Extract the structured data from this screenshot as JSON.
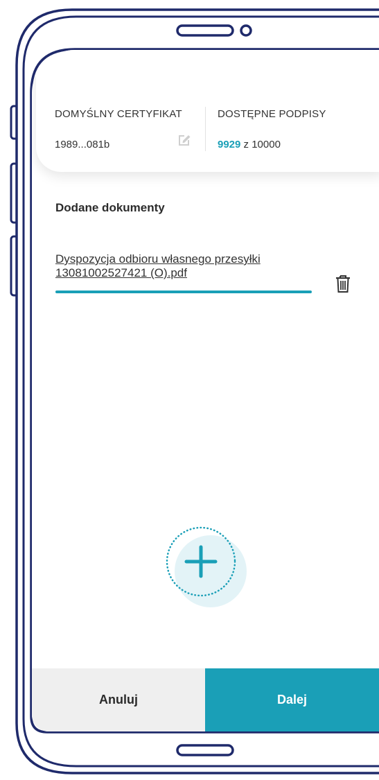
{
  "certificate": {
    "title": "DOMYŚLNY CERTYFIKAT",
    "value": "1989...081b"
  },
  "signatures": {
    "title": "DOSTĘPNE PODPISY",
    "available": "9929",
    "suffix": " z 10000"
  },
  "documents": {
    "section_title": "Dodane dokumenty",
    "items": [
      {
        "filename": "Dyspozycja odbioru własnego przesyłki 13081002527421 (O).pdf"
      }
    ]
  },
  "footer": {
    "cancel_label": "Anuluj",
    "next_label": "Dalej"
  },
  "icons": {
    "edit": "edit-icon",
    "delete": "trash-icon",
    "add": "plus-icon"
  },
  "colors": {
    "accent": "#1a9fb7",
    "frame": "#1f2a6b",
    "cancel_bg": "#efefef",
    "add_bg": "#e3f3f7"
  }
}
